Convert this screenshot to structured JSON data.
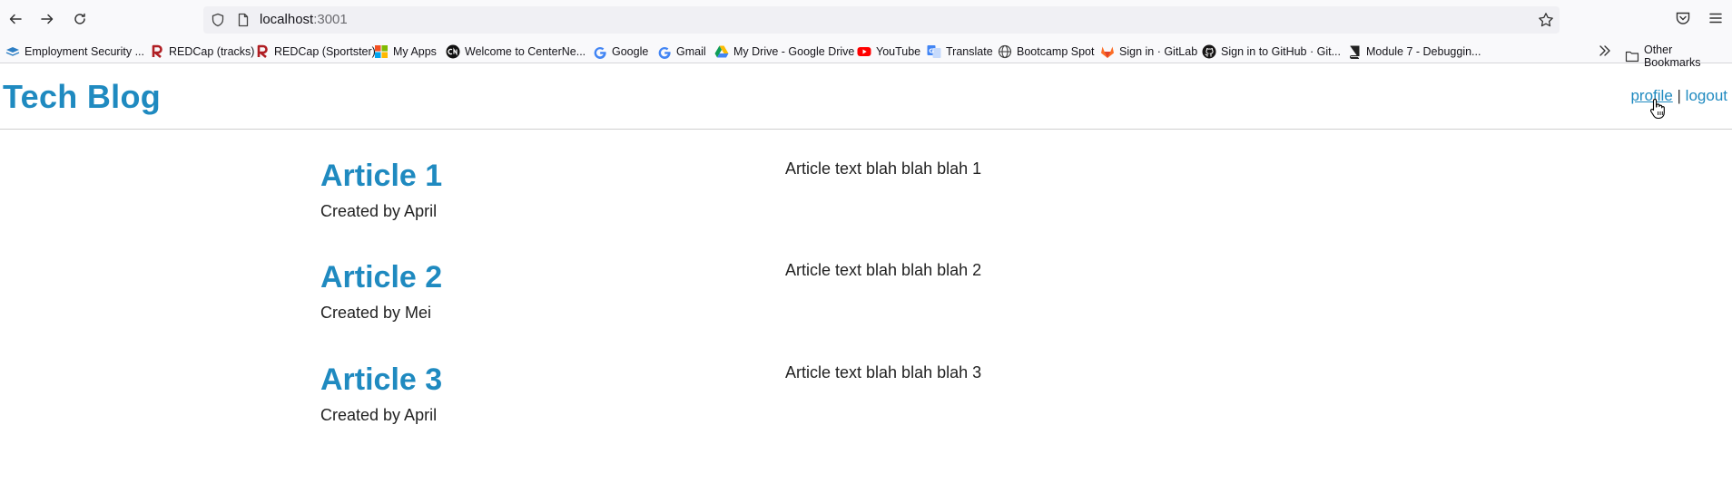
{
  "browser": {
    "url_host": "localhost",
    "url_port": ":3001",
    "bookmarks": [
      {
        "label": "Employment Security ...",
        "icon": "layers-icon"
      },
      {
        "label": "REDCap (tracks)",
        "icon": "redcap-icon"
      },
      {
        "label": "REDCap (Sportster)",
        "icon": "redcap-icon"
      },
      {
        "label": "My Apps",
        "icon": "apps-grid-icon"
      },
      {
        "label": "Welcome to CenterNe...",
        "icon": "cn-icon"
      },
      {
        "label": "Google",
        "icon": "google-icon"
      },
      {
        "label": "Gmail",
        "icon": "google-icon"
      },
      {
        "label": "My Drive - Google Drive",
        "icon": "drive-icon"
      },
      {
        "label": "YouTube",
        "icon": "youtube-icon"
      },
      {
        "label": "Translate",
        "icon": "translate-icon"
      },
      {
        "label": "Bootcamp Spot",
        "icon": "globe-icon"
      },
      {
        "label": "Sign in · GitLab",
        "icon": "gitlab-icon"
      },
      {
        "label": "Sign in to GitHub · Git...",
        "icon": "github-icon"
      },
      {
        "label": "Module 7 - Debuggin...",
        "icon": "book-icon"
      }
    ],
    "other_bookmarks": "Other Bookmarks"
  },
  "site": {
    "title": "Tech Blog",
    "nav": {
      "profile": "profile",
      "separator": "|",
      "logout": "logout"
    }
  },
  "articles": [
    {
      "title": "Article 1",
      "author": "Created by April",
      "body": "Article text blah blah blah 1"
    },
    {
      "title": "Article 2",
      "author": "Created by Mei",
      "body": "Article text blah blah blah 2"
    },
    {
      "title": "Article 3",
      "author": "Created by April",
      "body": "Article text blah blah blah 3"
    }
  ],
  "colors": {
    "accent": "#1f8ac0",
    "text": "#222222",
    "divider": "#d0d0d0"
  }
}
